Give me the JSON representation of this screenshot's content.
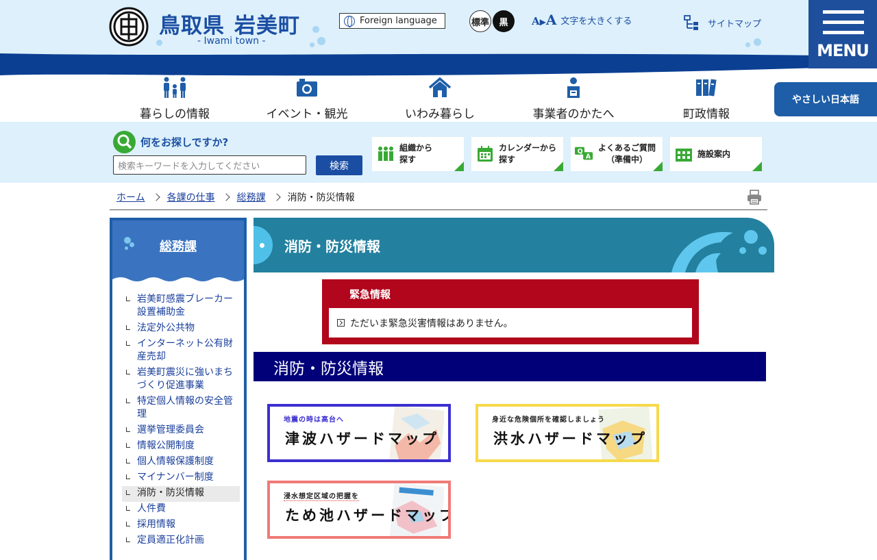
{
  "header": {
    "pref": "鳥取県",
    "town": "岩美町",
    "sub": "- Iwami town -",
    "foreign_language": "Foreign language",
    "color_standard": "標準",
    "color_black": "黒",
    "font_enlarge": "文字を大きくする",
    "sitemap": "サイトマップ",
    "menu": "MENU"
  },
  "nav": [
    {
      "label": "暮らしの情報",
      "icon": "family-icon"
    },
    {
      "label": "イベント・観光",
      "icon": "camera-icon"
    },
    {
      "label": "いわみ暮らし",
      "icon": "house-icon"
    },
    {
      "label": "事業者のかたへ",
      "icon": "businessperson-icon"
    },
    {
      "label": "町政情報",
      "icon": "binders-icon"
    }
  ],
  "easy_japanese": "やさしい日本語",
  "search": {
    "title": "何をお探しですか?",
    "placeholder": "検索キーワードを入力してください",
    "button": "検索"
  },
  "quick_links": [
    {
      "label1": "組織から",
      "label2": "探す",
      "icon": "organization-icon"
    },
    {
      "label1": "カレンダーから",
      "label2": "探す",
      "icon": "calendar-icon"
    },
    {
      "label1": "よくあるご質問",
      "label2": "（準備中）",
      "icon": "qa-icon"
    },
    {
      "label1": "施設案内",
      "label2": "",
      "icon": "building-icon"
    }
  ],
  "breadcrumb": [
    "ホーム",
    "各課の仕事",
    "総務課",
    "消防・防災情報"
  ],
  "sidebar": {
    "title": "総務課",
    "items": [
      "岩美町感震ブレーカー設置補助金",
      "法定外公共物",
      "インターネット公有財産売却",
      "岩美町震災に強いまちづくり促進事業",
      "特定個人情報の安全管理",
      "選挙管理委員会",
      "情報公開制度",
      "個人情報保護制度",
      "マイナンバー制度",
      "消防・防災情報",
      "人件費",
      "採用情報",
      "定員適正化計画"
    ]
  },
  "page_title": "消防・防災情報",
  "emergency": {
    "title": "緊急情報",
    "message": "ただいま緊急災害情報はありません。"
  },
  "section_title": "消防・防災情報",
  "banners": [
    {
      "small": "地震の時は高台へ",
      "big": "津波ハザードマップ",
      "color": "#3b2fd0"
    },
    {
      "small": "身近な危険個所を確認しましょう",
      "big": "洪水ハザードマップ",
      "color": "#f7d94a"
    },
    {
      "small": "浸水想定区域の把握を",
      "big": "ため池ハザードマップ",
      "color": "#ef7a78"
    }
  ],
  "colors": {
    "brand_blue": "#1e5ea8",
    "header_bg": "#ddf0fb",
    "emergency_red": "#b1061c",
    "section_navy": "#020079",
    "page_head_teal": "#23809f",
    "accent_green": "#39a935"
  }
}
